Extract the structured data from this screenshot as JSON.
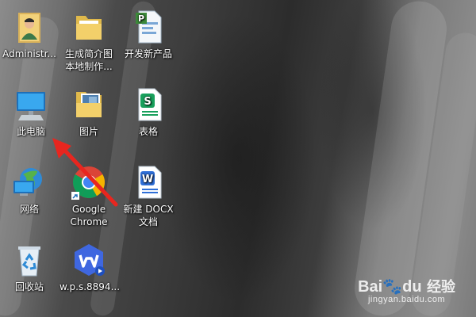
{
  "desktop": {
    "icons": [
      {
        "name": "admin-user-folder",
        "label": "Administr...",
        "icon": "user-folder-icon"
      },
      {
        "name": "brochure-folder",
        "label": "生成简介图\n本地制作...",
        "icon": "folder-icon"
      },
      {
        "name": "new-product-file",
        "label": "开发新产品",
        "icon": "project-file-icon"
      },
      {
        "name": "this-pc",
        "label": "此电脑",
        "icon": "computer-icon"
      },
      {
        "name": "pictures-folder",
        "label": "图片",
        "icon": "pictures-folder-icon"
      },
      {
        "name": "spreadsheet-file",
        "label": "表格",
        "icon": "spreadsheet-icon"
      },
      {
        "name": "network",
        "label": "网络",
        "icon": "network-icon"
      },
      {
        "name": "google-chrome",
        "label": "Google\nChrome",
        "icon": "chrome-icon"
      },
      {
        "name": "new-docx-file",
        "label": "新建 DOCX\n文档",
        "icon": "word-document-icon"
      },
      {
        "name": "recycle-bin",
        "label": "回收站",
        "icon": "recycle-bin-icon"
      },
      {
        "name": "wps-installer",
        "label": "w.p.s.8894...",
        "icon": "wps-icon"
      }
    ]
  },
  "annotation": {
    "type": "arrow",
    "color": "#e8261f"
  },
  "watermark": {
    "brand": "Bai",
    "brand_suffix": "du",
    "product": "经验",
    "domain": "jingyan.baidu.com"
  }
}
